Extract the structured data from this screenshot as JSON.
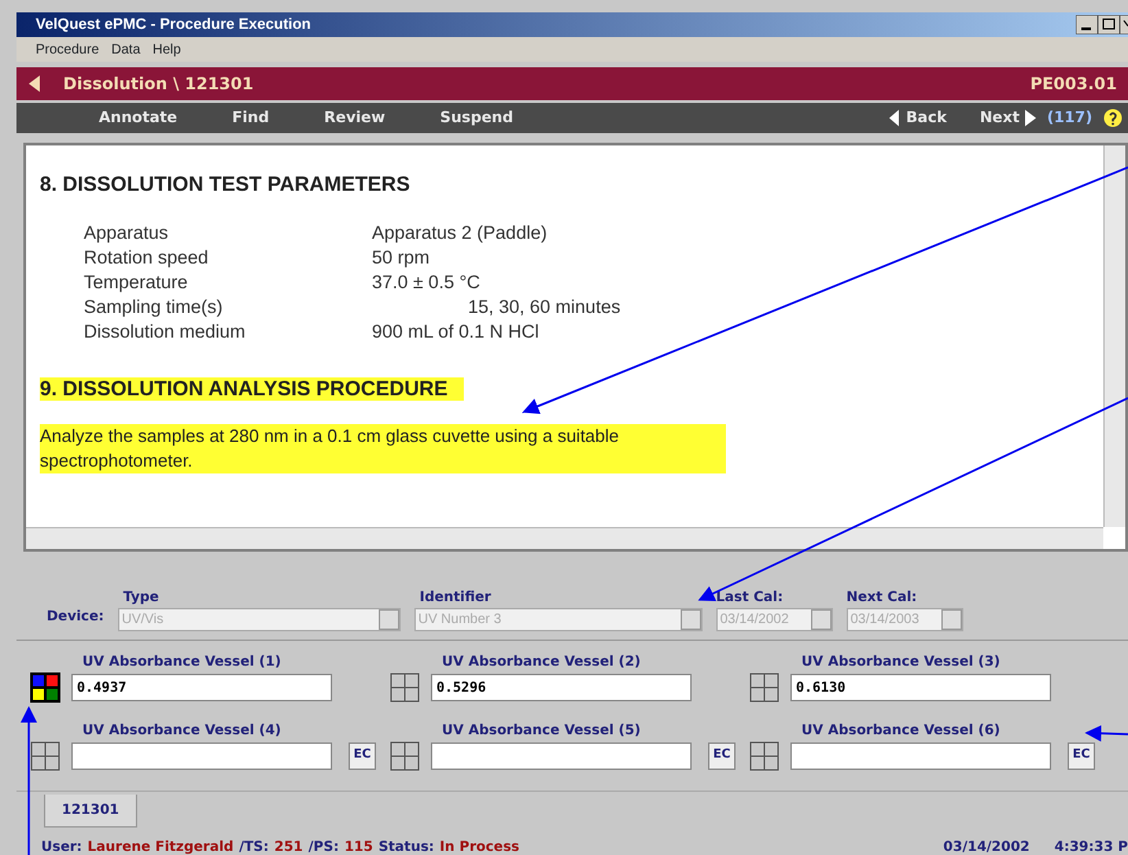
{
  "window": {
    "title": "VelQuest ePMC - Procedure Execution"
  },
  "menu": [
    {
      "label": "Procedure"
    },
    {
      "label": "Data"
    },
    {
      "label": "Help"
    }
  ],
  "header": {
    "title": "Dissolution \\ 121301",
    "code": "PE003.01"
  },
  "toolbar": {
    "actions": [
      "Annotate",
      "Find",
      "Review",
      "Suspend"
    ],
    "back": "Back",
    "next": "Next",
    "count": "(117)"
  },
  "document": {
    "blocks": [
      {
        "kind": "heading",
        "text": "8. DISSOLUTION TEST PARAMETERS",
        "highlighted": false
      },
      {
        "kind": "params",
        "rows": [
          {
            "label": "Apparatus",
            "value": "Apparatus 2 (Paddle)"
          },
          {
            "label": "Rotation speed",
            "value": "50 rpm"
          },
          {
            "label": "Temperature",
            "value": "37.0 ± 0.5 °C"
          },
          {
            "label": "Sampling time(s)",
            "value": "15, 30, 60 minutes",
            "indented": true
          },
          {
            "label": "Dissolution medium",
            "value": "900 mL of 0.1 N HCl"
          }
        ]
      },
      {
        "kind": "heading",
        "text": "9. DISSOLUTION ANALYSIS PROCEDURE",
        "highlighted": true
      },
      {
        "kind": "paragraph",
        "text": "Analyze the samples at 280 nm in a 0.1 cm glass cuvette using a suitable spectrophotometer.",
        "highlighted": true
      }
    ]
  },
  "device": {
    "label": "Device:",
    "fields": [
      {
        "label": "Type",
        "value": "UV/Vis",
        "disabled": true
      },
      {
        "label": "Identifier",
        "value": "UV Number 3",
        "disabled": true
      },
      {
        "label": "Last Cal:",
        "value": "03/14/2002",
        "disabled": true
      },
      {
        "label": "Next Cal:",
        "value": "03/14/2003",
        "disabled": true
      }
    ]
  },
  "vessels": [
    {
      "label": "UV Absorbance Vessel (1)",
      "value": "0.4937",
      "kind": "status"
    },
    {
      "label": "UV Absorbance Vessel (2)",
      "value": "0.5296",
      "kind": "grid"
    },
    {
      "label": "UV Absorbance Vessel (3)",
      "value": "0.6130",
      "kind": "grid"
    },
    {
      "label": "UV Absorbance Vessel (4)",
      "kind": "grid",
      "button": "EC"
    },
    {
      "label": "UV Absorbance Vessel (5)",
      "kind": "grid",
      "button": "EC"
    },
    {
      "label": "UV Absorbance Vessel (6)",
      "kind": "grid",
      "button": "EC"
    }
  ],
  "tabs": [
    {
      "label": "121301",
      "selected": true
    }
  ],
  "status_bar": {
    "user_label": "User:",
    "user": "Laurene Fitzgerald",
    "ts_label": "/TS:",
    "ts": "251",
    "ps_label": "/PS:",
    "ps": "115",
    "status_label": "Status:",
    "status": "In Process",
    "date": "03/14/2002",
    "time": "4:39:33 P"
  }
}
